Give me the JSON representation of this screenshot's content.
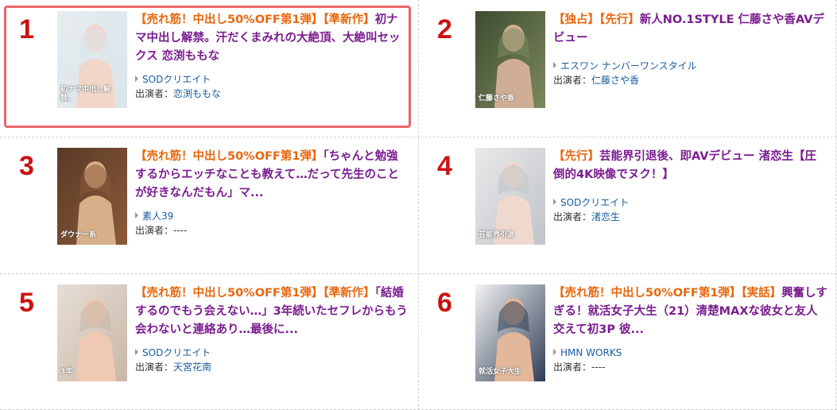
{
  "items": [
    {
      "rank": "1",
      "tags": [
        "【売れ筋！中出し50%OFF第1弾】",
        "【準新作】"
      ],
      "title": "初ナマ中出し解禁。汗だくまみれの大絶頂、大絶叫セックス 恋渕ももな",
      "maker": "SODクリエイト",
      "performer_label": "出演者：",
      "performer": "恋渕ももな",
      "selected": true,
      "palette": [
        "#e7ecef",
        "#f2d6c8",
        "#d9e4ea"
      ],
      "cover_text": "初ナマ中出し解禁。"
    },
    {
      "rank": "2",
      "tags": [
        "【独占】",
        "【先行】"
      ],
      "title": "新人NO.1STYLE 仁藤さや香AVデビュー",
      "maker": "エスワン ナンバーワンスタイル",
      "performer_label": "出演者：",
      "performer": "仁藤さや香",
      "selected": false,
      "palette": [
        "#3f4b2f",
        "#cfae95",
        "#7c8a5e"
      ],
      "cover_text": "仁藤さや香"
    },
    {
      "rank": "3",
      "tags": [
        "【売れ筋！中出し50%OFF第1弾】"
      ],
      "title": "「ちゃんと勉強するからエッチなことも教えて…だって先生のことが好きなんだもん」マ...",
      "maker": "素人39",
      "performer_label": "出演者：",
      "performer": "----",
      "selected": false,
      "palette": [
        "#5a3a26",
        "#d7b089",
        "#8c5a3a"
      ],
      "cover_text": "ダウナー系"
    },
    {
      "rank": "4",
      "tags": [
        "【先行】"
      ],
      "title": "芸能界引退後、即AVデビュー 渚恋生【圧倒的4K映像でヌク！】",
      "maker": "SODクリエイト",
      "performer_label": "出演者：",
      "performer": "渚恋生",
      "selected": false,
      "palette": [
        "#e9e9ea",
        "#efd9cf",
        "#bfc4c9"
      ],
      "cover_text": "芸能界引退"
    },
    {
      "rank": "5",
      "tags": [
        "【売れ筋！中出し50%OFF第1弾】",
        "【準新作】"
      ],
      "title": "「結婚するのでもう会えない…」3年続いたセフレからもう会わないと連絡あり…最後に...",
      "maker": "SODクリエイト",
      "performer_label": "出演者：",
      "performer": "天宮花南",
      "selected": false,
      "palette": [
        "#e7ded6",
        "#f0c9b4",
        "#c9b7a8"
      ],
      "cover_text": "3年"
    },
    {
      "rank": "6",
      "tags": [
        "【売れ筋！中出し50%OFF第1弾】",
        "【実話】"
      ],
      "title": "興奮しすぎる！就活女子大生（21）清楚MAXな彼女と友人交えて初3P 彼...",
      "maker": "HMN WORKS",
      "performer_label": "出演者：",
      "performer": "----",
      "selected": false,
      "palette": [
        "#f3f3f3",
        "#e3b79a",
        "#2f3e56"
      ],
      "cover_text": "就活女子大生"
    }
  ]
}
